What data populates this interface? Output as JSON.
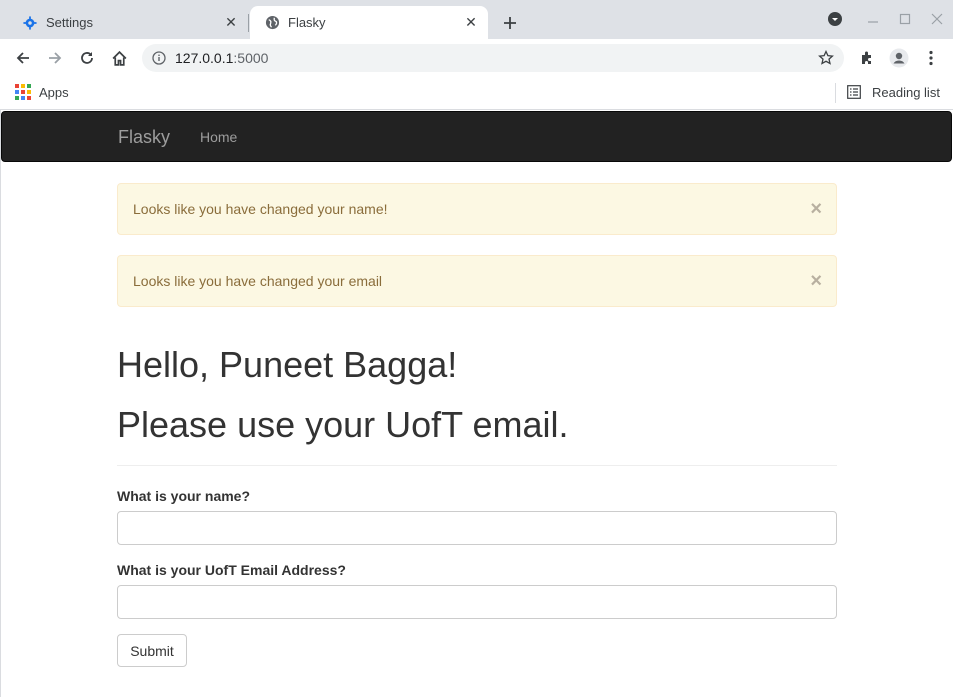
{
  "browser": {
    "tabs": [
      {
        "title": "Settings",
        "icon": "gear-icon"
      },
      {
        "title": "Flasky",
        "icon": "globe-icon"
      }
    ],
    "url_host": "127.0.0.1",
    "url_port": ":5000",
    "bookmarks": {
      "apps_label": "Apps",
      "reading_list_label": "Reading list"
    }
  },
  "navbar": {
    "brand": "Flasky",
    "links": [
      "Home"
    ]
  },
  "alerts": [
    {
      "message": "Looks like you have changed your name!",
      "close": "×"
    },
    {
      "message": "Looks like you have changed your email",
      "close": "×"
    }
  ],
  "header": {
    "greeting": "Hello, Puneet Bagga!",
    "notice": "Please use your UofT email."
  },
  "form": {
    "name_label": "What is your name?",
    "name_value": "",
    "email_label": "What is your UofT Email Address?",
    "email_value": "",
    "submit_label": "Submit"
  },
  "colors": {
    "navbar_bg": "#222222",
    "alert_bg": "#fcf8e3",
    "alert_text": "#8a6d3b"
  }
}
